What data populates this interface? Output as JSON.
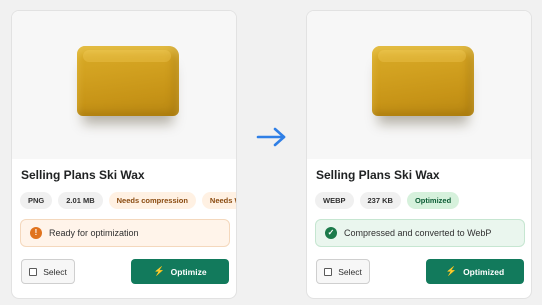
{
  "cards": [
    {
      "title": "Selling Plans Ski Wax",
      "badges": [
        "PNG",
        "2.01 MB",
        "Needs compression",
        "Needs WebP"
      ],
      "status": "Ready for optimization",
      "status_icon": "!",
      "select_label": "Select",
      "optimize_label": "Optimize"
    },
    {
      "title": "Selling Plans Ski Wax",
      "badges": [
        "WEBP",
        "237 KB",
        "Optimized"
      ],
      "status": "Compressed and converted to WebP",
      "status_icon": "✓",
      "select_label": "Select",
      "optimize_label": "Optimized"
    }
  ],
  "icons": {
    "bolt": "⚡",
    "arrow": "right-arrow-icon"
  },
  "colors": {
    "accent": "#127a5c",
    "arrow": "#2f7fe6",
    "warning": "#e0731e",
    "success": "#1c7a4a"
  }
}
